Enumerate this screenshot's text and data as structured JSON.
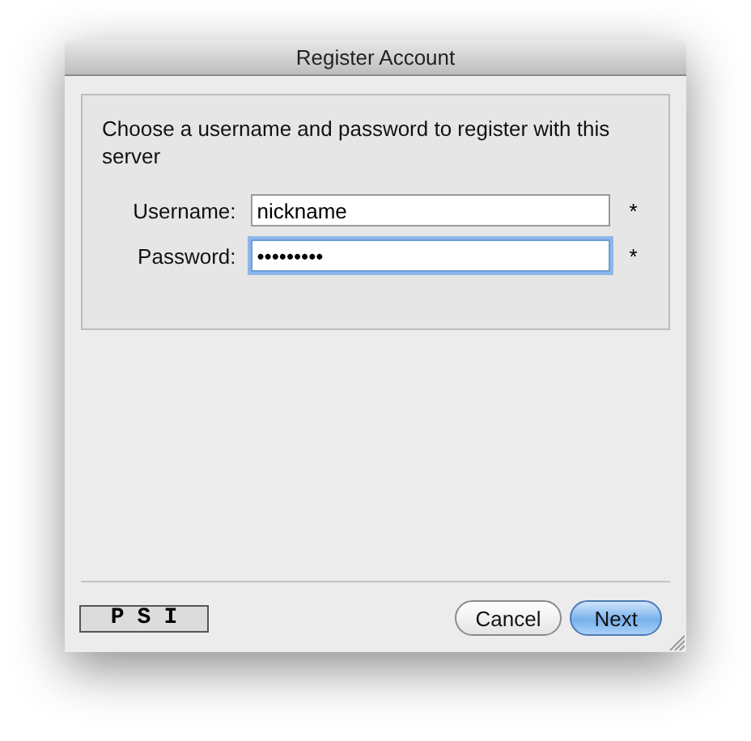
{
  "window": {
    "title": "Register Account"
  },
  "instructions": "Choose a username and password to register with this server",
  "fields": [
    {
      "label": "Username:",
      "value": "nickname",
      "required_mark": "*",
      "focused": false
    },
    {
      "label": "Password:",
      "value": "•••••••••",
      "required_mark": "*",
      "focused": true
    }
  ],
  "logo": {
    "text": "PSI"
  },
  "buttons": [
    {
      "label": "Cancel",
      "default": false
    },
    {
      "label": "Next",
      "default": true
    }
  ]
}
